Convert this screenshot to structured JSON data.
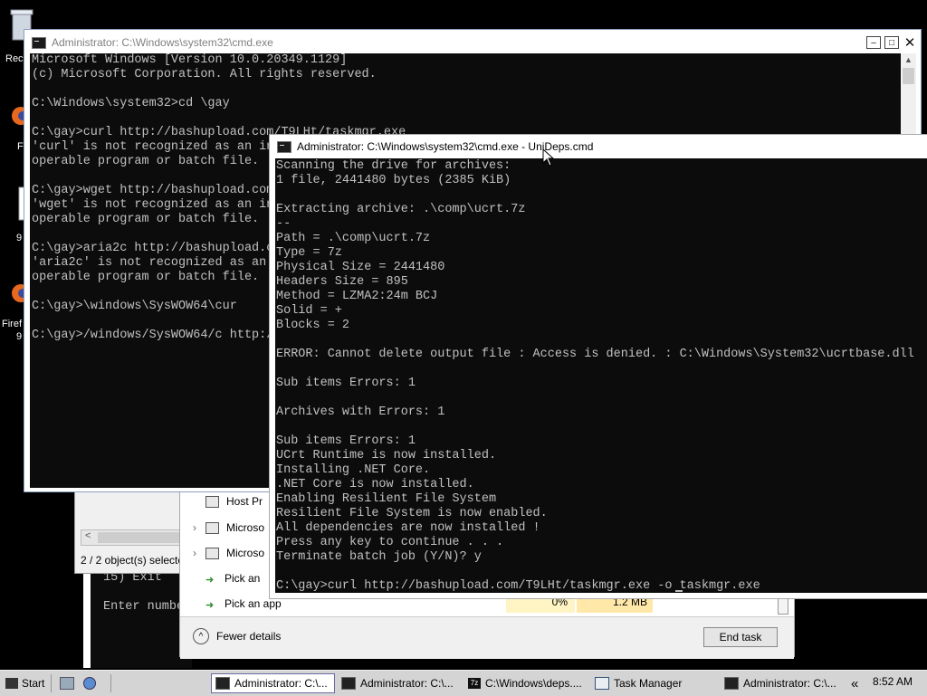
{
  "desktop": {
    "icons": [
      {
        "label": "Rec",
        "icon": "recycle-bin-icon"
      },
      {
        "label": "F",
        "icon": "firefox-icon"
      },
      {
        "label": "9",
        "icon": "file-icon"
      },
      {
        "label": "Firef",
        "sublabel": "9",
        "icon": "firefox-icon"
      }
    ]
  },
  "back_cmd": {
    "title": "Administrator: C:\\Windows\\system32\\cmd.exe",
    "lines": [
      "Microsoft Windows [Version 10.0.20349.1129]",
      "(c) Microsoft Corporation. All rights reserved.",
      "",
      "C:\\Windows\\system32>cd \\gay",
      "",
      "C:\\gay>curl http://bashupload.com/T9LHt/taskmgr.exe",
      "'curl' is not recognized as an in",
      "operable program or batch file.",
      "",
      "C:\\gay>wget http://bashupload.com",
      "'wget' is not recognized as an in",
      "operable program or batch file.",
      "",
      "C:\\gay>aria2c http://bashupload.c",
      "'aria2c' is not recognized as an",
      "operable program or batch file.",
      "",
      "C:\\gay>\\windows\\SysWOW64\\cur",
      "",
      "C:\\gay>/windows/SysWOW64/c http:/"
    ]
  },
  "front_cmd": {
    "title": "Administrator: C:\\Windows\\system32\\cmd.exe - UniDeps.cmd",
    "lines": [
      "Scanning the drive for archives:",
      "1 file, 2441480 bytes (2385 KiB)",
      "",
      "Extracting archive: .\\comp\\ucrt.7z",
      "--",
      "Path = .\\comp\\ucrt.7z",
      "Type = 7z",
      "Physical Size = 2441480",
      "Headers Size = 895",
      "Method = LZMA2:24m BCJ",
      "Solid = +",
      "Blocks = 2",
      "",
      "ERROR: Cannot delete output file : Access is denied. : C:\\Windows\\System32\\ucrtbase.dll",
      "",
      "Sub items Errors: 1",
      "",
      "Archives with Errors: 1",
      "",
      "Sub items Errors: 1",
      "UCrt Runtime is now installed.",
      "Installing .NET Core.",
      ".NET Core is now installed.",
      "Enabling Resilient File System",
      "Resilient File System is now enabled.",
      "All dependencies are now installed !",
      "Press any key to continue . . .",
      "Terminate batch job (Y/N)? y",
      "",
      "C:\\gay>curl http://bashupload.com/T9LHt/taskmgr.exe -o taskmgr.exe"
    ]
  },
  "explorer_window": {
    "status": "2 / 2 object(s) selecte",
    "scroll_left": "<"
  },
  "menu_window": {
    "lines": [
      "15) Exit",
      "",
      "Enter numbe"
    ]
  },
  "task_manager": {
    "rows": [
      {
        "name": "Host Pr",
        "expandable": false
      },
      {
        "name": "Microso",
        "expandable": true
      },
      {
        "name": "Microso",
        "expandable": true
      },
      {
        "name": "Pick an",
        "expandable": false
      },
      {
        "name": "Pick an app",
        "expandable": false,
        "cpu": "0%",
        "mem": "1.2 MB"
      }
    ],
    "fewer_details": "Fewer details",
    "end_task": "End task"
  },
  "taskbar": {
    "start": "Start",
    "buttons": [
      {
        "label": "Administrator: C:\\...",
        "active": true
      },
      {
        "label": "Administrator: C:\\...",
        "active": false
      },
      {
        "label": "C:\\Windows\\deps....",
        "active": false
      },
      {
        "label": "Task Manager",
        "active": false
      },
      {
        "label": "Administrator: C:\\...",
        "active": false
      }
    ],
    "tray_chevron": "«",
    "clock": "8:52 AM"
  },
  "colors": {
    "console_bg": "#0c0c0c",
    "console_text": "#c0c0c0",
    "taskbar_bg": "#d4d4d4"
  }
}
